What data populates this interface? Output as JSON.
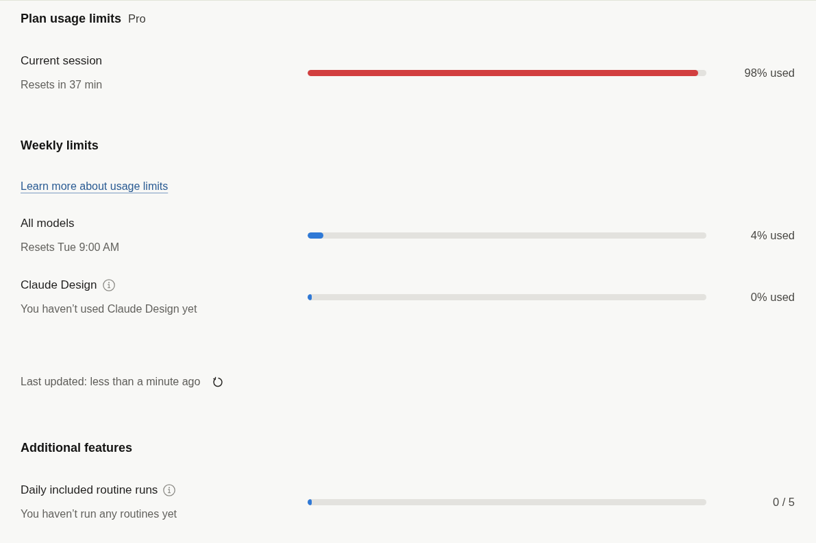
{
  "plan_usage": {
    "title": "Plan usage limits",
    "plan": "Pro",
    "meters": [
      {
        "label": "Current session",
        "info": false,
        "detail": "Resets in 37 min",
        "level": 0.98,
        "color": "#d23f3f",
        "reading": "98% used"
      }
    ]
  },
  "weekly_limits": {
    "title": "Weekly limits",
    "link": "Learn more about usage limits",
    "meters": [
      {
        "label": "All models",
        "info": false,
        "detail": "Resets Tue 9:00 AM",
        "level": 0.04,
        "color": "#2f79d6",
        "reading": "4% used"
      },
      {
        "label": "Claude Design",
        "info": true,
        "detail": "You haven’t used Claude Design yet",
        "level": 0,
        "color": "#2f79d6",
        "reading": "0% used"
      }
    ]
  },
  "last_updated": {
    "text": "Last updated: less than a minute ago"
  },
  "additional_features": {
    "title": "Additional features",
    "meters": [
      {
        "label": "Daily included routine runs",
        "info": true,
        "detail": "You haven’t run any routines yet",
        "level": 0,
        "color": "#2f79d6",
        "reading": "0 / 5"
      }
    ]
  }
}
